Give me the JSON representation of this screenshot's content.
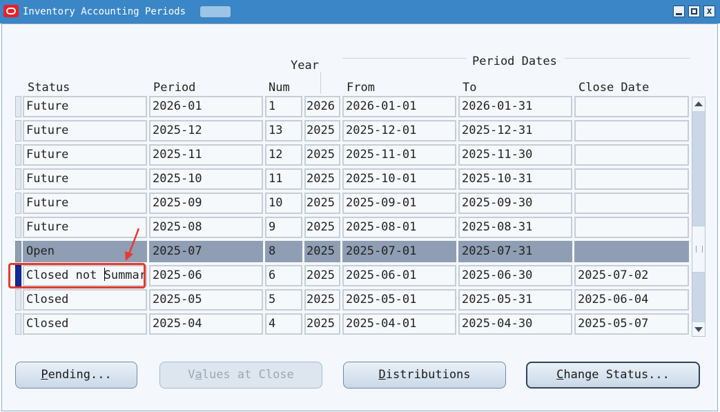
{
  "window": {
    "title": "Inventory Accounting Periods",
    "buttons": {
      "minimize": "minimize",
      "maximize": "maximize",
      "close": "x"
    }
  },
  "columns": {
    "year_group": "Year",
    "period_dates_group": "Period Dates",
    "status": "Status",
    "period": "Period",
    "num": "Num",
    "from": "From",
    "to": "To",
    "close_date": "Close Date"
  },
  "rows": [
    {
      "status": "Future",
      "period": "2026-01",
      "num": "1",
      "year": "2026",
      "from": "2026-01-01",
      "to": "2026-01-31",
      "close_date": ""
    },
    {
      "status": "Future",
      "period": "2025-12",
      "num": "13",
      "year": "2025",
      "from": "2025-12-01",
      "to": "2025-12-31",
      "close_date": ""
    },
    {
      "status": "Future",
      "period": "2025-11",
      "num": "12",
      "year": "2025",
      "from": "2025-11-01",
      "to": "2025-11-30",
      "close_date": ""
    },
    {
      "status": "Future",
      "period": "2025-10",
      "num": "11",
      "year": "2025",
      "from": "2025-10-01",
      "to": "2025-10-31",
      "close_date": ""
    },
    {
      "status": "Future",
      "period": "2025-09",
      "num": "10",
      "year": "2025",
      "from": "2025-09-01",
      "to": "2025-09-30",
      "close_date": ""
    },
    {
      "status": "Future",
      "period": "2025-08",
      "num": "9",
      "year": "2025",
      "from": "2025-08-01",
      "to": "2025-08-31",
      "close_date": ""
    },
    {
      "status": "Open",
      "period": "2025-07",
      "num": "8",
      "year": "2025",
      "from": "2025-07-01",
      "to": "2025-07-31",
      "close_date": ""
    },
    {
      "status": "Closed not Summar",
      "period": "2025-06",
      "num": "6",
      "year": "2025",
      "from": "2025-06-01",
      "to": "2025-06-30",
      "close_date": "2025-07-02",
      "status_pre_cursor": "Closed not ",
      "status_post_cursor": "Summar"
    },
    {
      "status": "Closed",
      "period": "2025-05",
      "num": "5",
      "year": "2025",
      "from": "2025-05-01",
      "to": "2025-05-31",
      "close_date": "2025-06-04"
    },
    {
      "status": "Closed",
      "period": "2025-04",
      "num": "4",
      "year": "2025",
      "from": "2025-04-01",
      "to": "2025-04-30",
      "close_date": "2025-05-07"
    }
  ],
  "buttons": {
    "pending": {
      "mnemonic": "P",
      "rest": "ending..."
    },
    "values_at_close": {
      "pre": "V",
      "mnemonic": "a",
      "rest": "lues at Close"
    },
    "distributions": {
      "mnemonic": "D",
      "rest": "istributions"
    },
    "change_status": {
      "mnemonic": "C",
      "rest": "hange Status..."
    }
  },
  "colors": {
    "titlebar": "#3a86c6",
    "open_row": "#8f9eb3",
    "selected_indicator": "#132a9a",
    "annotation": "#e63a2e"
  }
}
